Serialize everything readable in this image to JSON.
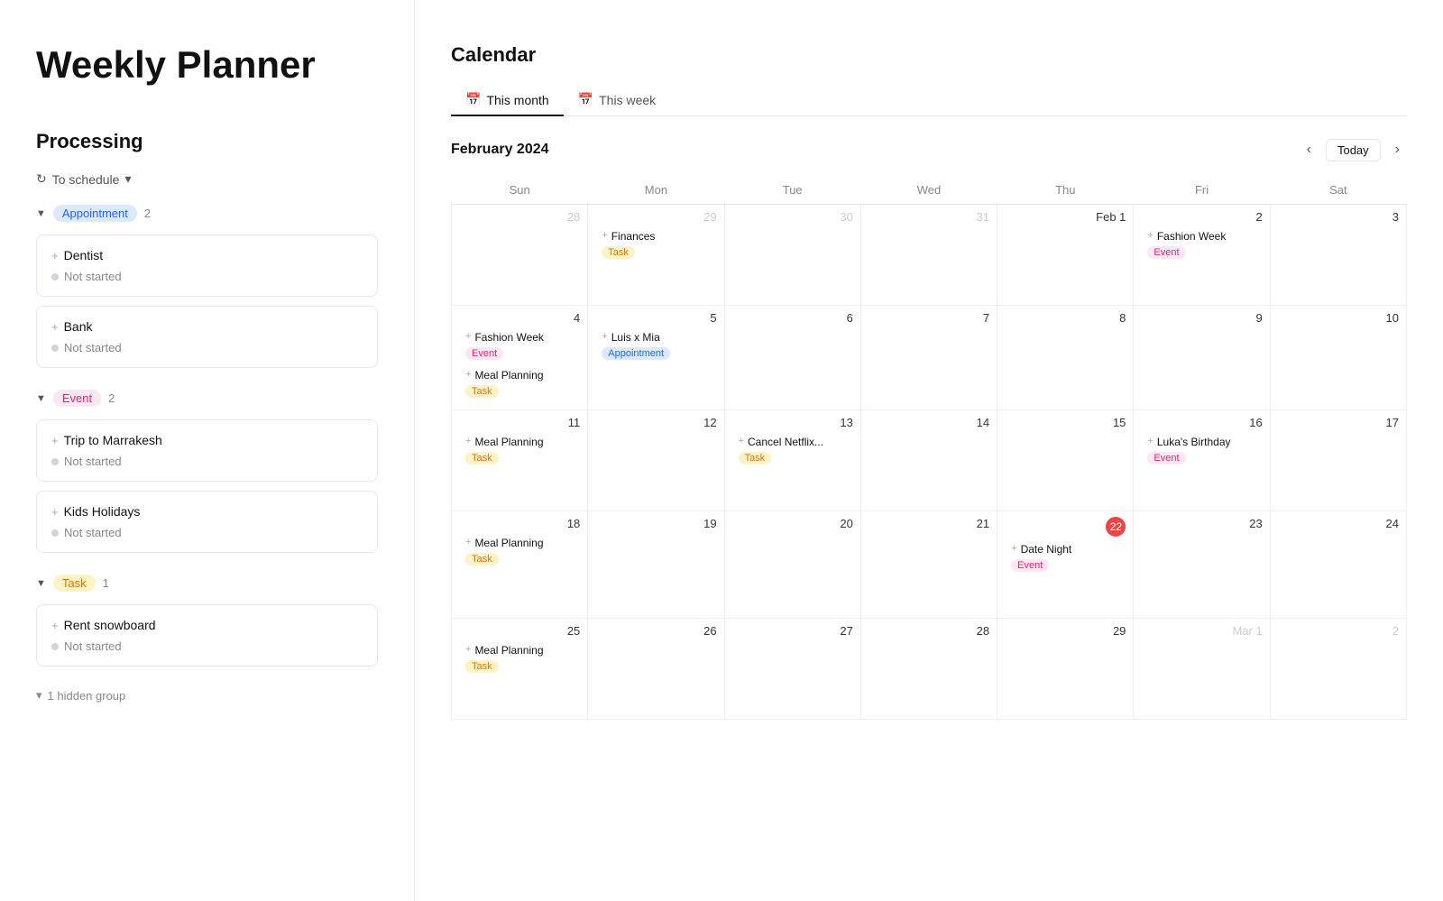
{
  "page": {
    "title": "Weekly Planner"
  },
  "left": {
    "section_title": "Processing",
    "schedule_label": "To schedule",
    "groups": [
      {
        "name": "Appointment",
        "badge_class": "badge-appointment",
        "count": 2,
        "tasks": [
          {
            "title": "Dentist",
            "status": "Not started"
          },
          {
            "title": "Bank",
            "status": "Not started"
          }
        ]
      },
      {
        "name": "Event",
        "badge_class": "badge-event",
        "count": 2,
        "tasks": [
          {
            "title": "Trip to Marrakesh",
            "status": "Not started"
          },
          {
            "title": "Kids Holidays",
            "status": "Not started"
          }
        ]
      },
      {
        "name": "Task",
        "badge_class": "badge-task",
        "count": 1,
        "tasks": [
          {
            "title": "Rent snowboard",
            "status": "Not started"
          }
        ]
      }
    ],
    "hidden_group": "1 hidden group"
  },
  "calendar": {
    "title": "Calendar",
    "tabs": [
      "This month",
      "This week"
    ],
    "active_tab": 0,
    "month_label": "February 2024",
    "today_label": "Today",
    "days": [
      "Sun",
      "Mon",
      "Tue",
      "Wed",
      "Thu",
      "Fri",
      "Sat"
    ],
    "weeks": [
      [
        {
          "num": "28",
          "type": "other",
          "events": []
        },
        {
          "num": "29",
          "type": "other",
          "events": [
            {
              "title": "Finances",
              "tag": "Task",
              "tag_class": "tag-task"
            }
          ]
        },
        {
          "num": "30",
          "type": "other",
          "events": []
        },
        {
          "num": "31",
          "type": "other",
          "events": []
        },
        {
          "num": "Feb 1",
          "type": "current",
          "events": []
        },
        {
          "num": "2",
          "type": "current",
          "events": [
            {
              "title": "Fashion Week",
              "tag": "Event",
              "tag_class": "tag-event"
            }
          ]
        },
        {
          "num": "3",
          "type": "current",
          "events": []
        }
      ],
      [
        {
          "num": "4",
          "type": "current",
          "events": [
            {
              "title": "Fashion Week",
              "tag": "Event",
              "tag_class": "tag-event"
            },
            {
              "title": "Meal Planning",
              "tag": "Task",
              "tag_class": "tag-task"
            }
          ]
        },
        {
          "num": "5",
          "type": "current",
          "events": [
            {
              "title": "Luis x Mia",
              "tag": "Appointment",
              "tag_class": "tag-appointment"
            }
          ]
        },
        {
          "num": "6",
          "type": "current",
          "events": []
        },
        {
          "num": "7",
          "type": "current",
          "events": []
        },
        {
          "num": "8",
          "type": "current",
          "events": []
        },
        {
          "num": "9",
          "type": "current",
          "events": []
        },
        {
          "num": "10",
          "type": "current",
          "events": []
        }
      ],
      [
        {
          "num": "11",
          "type": "current",
          "events": [
            {
              "title": "Meal Planning",
              "tag": "Task",
              "tag_class": "tag-task"
            }
          ]
        },
        {
          "num": "12",
          "type": "current",
          "events": []
        },
        {
          "num": "13",
          "type": "current",
          "events": [
            {
              "title": "Cancel Netflix...",
              "tag": "Task",
              "tag_class": "tag-task"
            }
          ]
        },
        {
          "num": "14",
          "type": "current",
          "events": []
        },
        {
          "num": "15",
          "type": "current",
          "events": []
        },
        {
          "num": "16",
          "type": "current",
          "events": [
            {
              "title": "Luka's Birthday",
              "tag": "Event",
              "tag_class": "tag-event"
            }
          ]
        },
        {
          "num": "17",
          "type": "current",
          "events": []
        }
      ],
      [
        {
          "num": "18",
          "type": "current",
          "events": [
            {
              "title": "Meal Planning",
              "tag": "Task",
              "tag_class": "tag-task"
            }
          ]
        },
        {
          "num": "19",
          "type": "current",
          "events": []
        },
        {
          "num": "20",
          "type": "current",
          "events": []
        },
        {
          "num": "21",
          "type": "current",
          "events": []
        },
        {
          "num": "22",
          "type": "today",
          "events": [
            {
              "title": "Date Night",
              "tag": "Event",
              "tag_class": "tag-event"
            }
          ]
        },
        {
          "num": "23",
          "type": "current",
          "events": []
        },
        {
          "num": "24",
          "type": "current",
          "events": []
        }
      ],
      [
        {
          "num": "25",
          "type": "current",
          "events": [
            {
              "title": "Meal Planning",
              "tag": "Task",
              "tag_class": "tag-task"
            }
          ]
        },
        {
          "num": "26",
          "type": "current",
          "events": []
        },
        {
          "num": "27",
          "type": "current",
          "events": []
        },
        {
          "num": "28",
          "type": "current",
          "events": []
        },
        {
          "num": "29",
          "type": "current",
          "events": []
        },
        {
          "num": "Mar 1",
          "type": "other",
          "events": []
        },
        {
          "num": "2",
          "type": "other",
          "events": []
        }
      ]
    ]
  }
}
